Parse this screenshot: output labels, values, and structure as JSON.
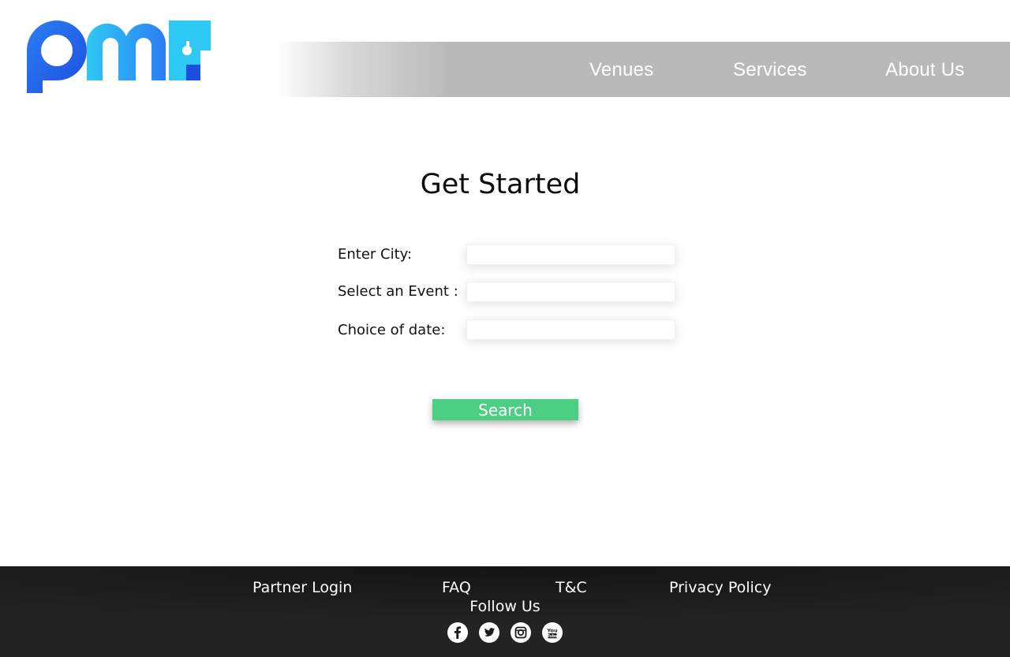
{
  "brand": {
    "logo_icon": "pmf-logo-icon",
    "colors": {
      "logo_blue": "#2f7bf2",
      "logo_cyan": "#2ec8f5",
      "logo_dark": "#1e4ee0"
    }
  },
  "nav": {
    "items": [
      {
        "label": "Venues"
      },
      {
        "label": "Services"
      },
      {
        "label": "About Us"
      }
    ],
    "color": "#b9b9b9"
  },
  "main": {
    "title": "Get Started",
    "fields": [
      {
        "label": "Enter City:",
        "value": "",
        "placeholder": ""
      },
      {
        "label": "Select an Event :",
        "value": "",
        "placeholder": ""
      },
      {
        "label": "Choice of date:",
        "value": "",
        "placeholder": ""
      }
    ],
    "search_label": "Search",
    "search_color": "#4ccf82"
  },
  "footer": {
    "links": [
      {
        "label": "Partner Login"
      },
      {
        "label": "FAQ"
      },
      {
        "label": "T&C"
      },
      {
        "label": "Privacy Policy"
      }
    ],
    "follow_label": "Follow Us",
    "social": [
      {
        "icon": "facebook-icon"
      },
      {
        "icon": "twitter-icon"
      },
      {
        "icon": "instagram-icon"
      },
      {
        "icon": "youtube-icon"
      }
    ],
    "background": "#1c1c1c"
  }
}
